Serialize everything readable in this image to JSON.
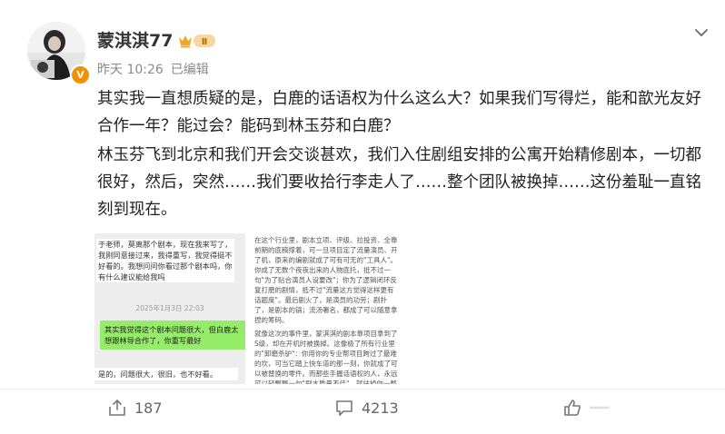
{
  "post": {
    "author": "蒙淇淇77",
    "level_badge": "Ⅱ",
    "verified_badge": "V",
    "time": "昨天 10:26",
    "edited": "已编辑",
    "paragraphs": [
      "其实我一直想质疑的是，白鹿的话语权为什么这么大？如果我们写得烂，能和歆光友好合作一年？能过会？能码到林玉芬和白鹿？",
      "林玉芬飞到北京和我们开会交谈甚欢，我们入住剧组安排的公寓开始精修剧本，一切都很好，然后，突然……我们要收拾行李走人了……整个团队被换掉……这份羞耻一直铭刻到现在。"
    ]
  },
  "images": {
    "chat": {
      "message_1": "于老师，莫离那个剧本，现在我来写了，我刚同意接过来，我得重写，我觉得挺不好看的。我想问问你看过那个剧本吗，你有什么建议能给我吗",
      "timestamp": "2025年1月3日 22:03",
      "message_2": "其实我觉得这个剧本问题很大，但白鹿太想跟林导合作了，你重写最好",
      "message_3": "是的，问题很大，很旧，也不好看。"
    },
    "text": {
      "paragraph_1": "在这个行业里，剧本立项、评级、拉投资、全靠前期的底稿撑着，可一旦项目定了流量演员、开了机，原来的编剧就成了可有可无的\"工具人\"。你成了无数个夜夜出来的人物底托，抵不过一句\"为了贴合演员人设要改\"；你为了逻辑闭环反复打磨的剧情，抵不过\"流量这方觉得这样更有话题度\"。最后剧火了，是演员的功劳；剧扑了，是剧本的锅；流汤署名，都成了可以随意拿捏的筹码。",
      "paragraph_2": "就像这次的事件里，蒙淇淇的剧本靠项目拿到了S级，却在开机时被换掉。这像极了所有行业里的\"卸磨杀驴\"：你用你的专业帮项目跨过了最难的坎，可当它踏上快车道的那一刻，你就成了可以被替换的零件。而那些手握话语权的人，永远可以轻飘飘一句\"剧本质量不佳\"，就抹掉你一整"
    }
  },
  "actions": {
    "share_count": "187",
    "comment_count": "4213"
  },
  "colors": {
    "accent_orange": "#f29100",
    "chat_green": "#95ec69",
    "text_gray": "#8a8a8a"
  },
  "icons": [
    "share-icon",
    "comment-icon",
    "like-icon",
    "more-icon",
    "level-badge-icon",
    "verified-icon"
  ]
}
